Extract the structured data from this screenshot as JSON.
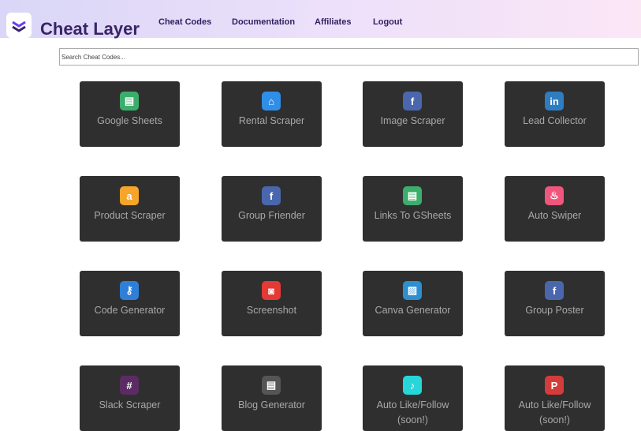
{
  "header": {
    "brand": "Cheat Layer",
    "nav": [
      "Cheat Codes",
      "Documentation",
      "Affiliates",
      "Logout"
    ]
  },
  "search": {
    "placeholder": "Search Cheat Codes..."
  },
  "cards": [
    {
      "label": "Google Sheets",
      "icon": "google-sheets-icon",
      "color": "#3cae6c",
      "glyph": "▤"
    },
    {
      "label": "Rental Scraper",
      "icon": "house-icon",
      "color": "#2f8fe8",
      "glyph": "⌂"
    },
    {
      "label": "Image Scraper",
      "icon": "facebook-icon",
      "color": "#4a67ad",
      "glyph": "f"
    },
    {
      "label": "Lead Collector",
      "icon": "linkedin-icon",
      "color": "#2f7cc0",
      "glyph": "in"
    },
    {
      "label": "Product Scraper",
      "icon": "amazon-icon",
      "color": "#f5a52c",
      "glyph": "a"
    },
    {
      "label": "Group Friender",
      "icon": "facebook-icon",
      "color": "#4a67ad",
      "glyph": "f"
    },
    {
      "label": "Links To GSheets",
      "icon": "google-sheets-icon",
      "color": "#3cae6c",
      "glyph": "▤"
    },
    {
      "label": "Auto Swiper",
      "icon": "tinder-icon",
      "color": "#f0557d",
      "glyph": "♨"
    },
    {
      "label": "Code Generator",
      "icon": "key-icon",
      "color": "#2f7fd8",
      "glyph": "⚷"
    },
    {
      "label": "Screenshot",
      "icon": "camera-icon",
      "color": "#e53935",
      "glyph": "◙"
    },
    {
      "label": "Canva Generator",
      "icon": "image-icon",
      "color": "#2d8fd0",
      "glyph": "▨"
    },
    {
      "label": "Group Poster",
      "icon": "facebook-icon",
      "color": "#4a67ad",
      "glyph": "f"
    },
    {
      "label": "Slack Scraper",
      "icon": "slack-icon",
      "color": "#5b2c63",
      "glyph": "#"
    },
    {
      "label": "Blog Generator",
      "icon": "newspaper-icon",
      "color": "#555555",
      "glyph": "▤"
    },
    {
      "label": "Auto Like/Follow (soon!)",
      "icon": "tiktok-icon",
      "color": "#27d6d8",
      "glyph": "♪"
    },
    {
      "label": "Auto Like/Follow (soon!)",
      "icon": "pinterest-icon",
      "color": "#d43b3b",
      "glyph": "P"
    }
  ]
}
